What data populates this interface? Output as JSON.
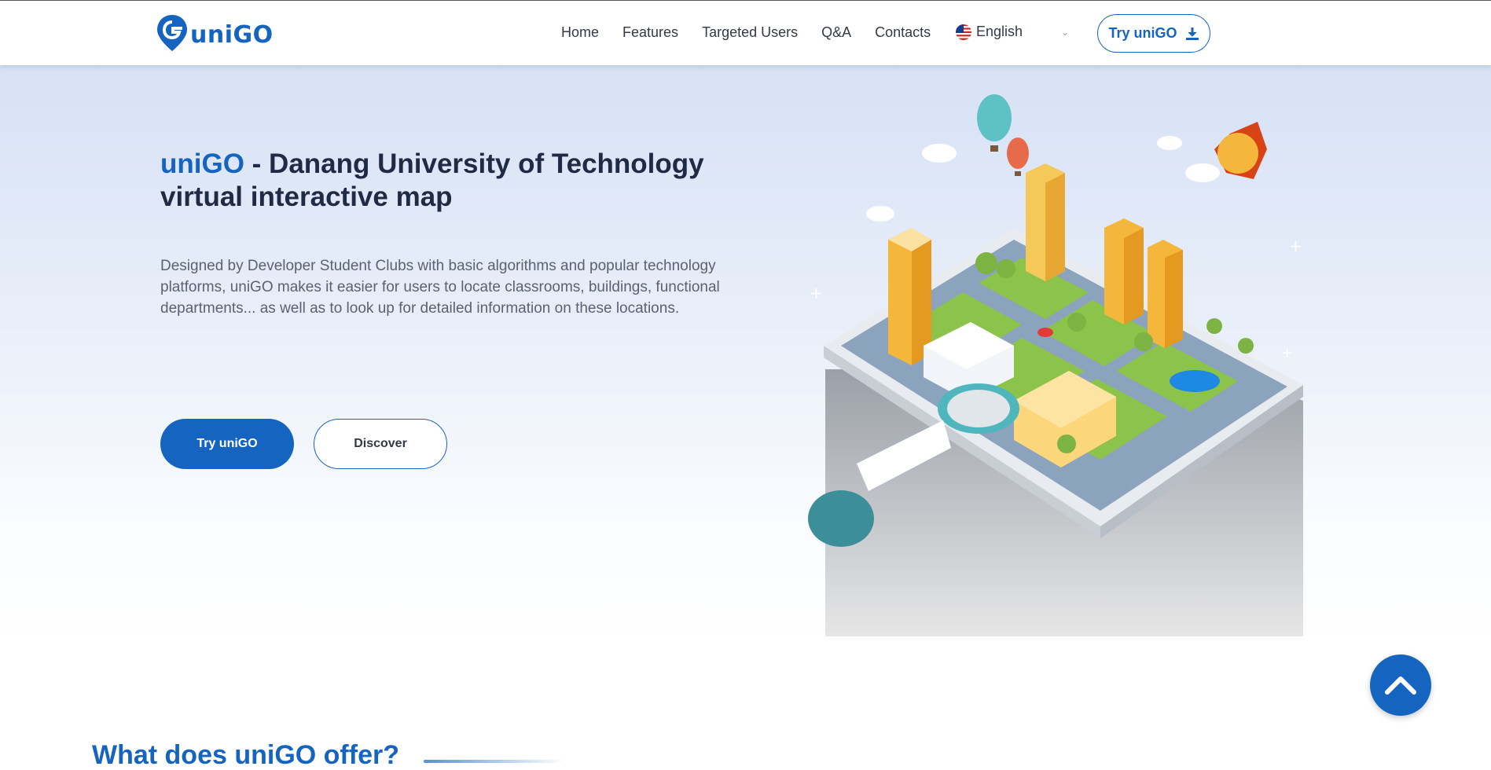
{
  "header": {
    "logo_text": "uniGO",
    "nav": [
      "Home",
      "Features",
      "Targeted Users",
      "Q&A",
      "Contacts"
    ],
    "language": "English",
    "try_label": "Try uniGO"
  },
  "hero": {
    "title_brand": "uniGO",
    "title_rest": " - Danang University of Technology virtual interactive map",
    "description": "Designed by Developer Student Clubs with basic algorithms and popular technology platforms, uniGO makes it easier for users to locate classrooms, buildings, functional departments... as well as to look up for detailed information on these locations.",
    "primary_button": "Try uniGO",
    "secondary_button": "Discover"
  },
  "section": {
    "title": "What does uniGO offer?"
  },
  "colors": {
    "brand": "#1565c0",
    "text_dark": "#1f2a44",
    "text_body": "#5a6270"
  }
}
